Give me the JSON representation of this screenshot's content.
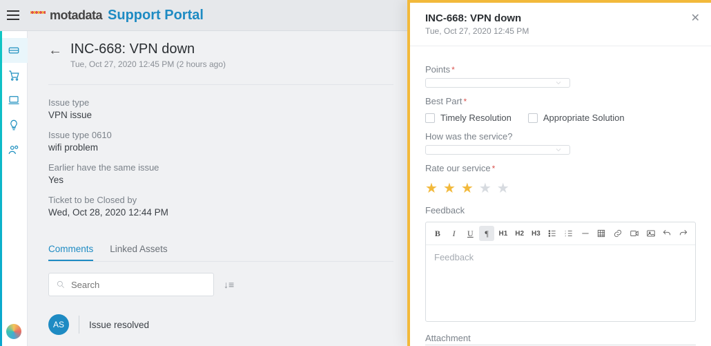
{
  "header": {
    "brand": "motadata",
    "portal": "Support Portal"
  },
  "sidebar": {
    "items": [
      {
        "name": "ticket-icon"
      },
      {
        "name": "cart-icon"
      },
      {
        "name": "laptop-icon"
      },
      {
        "name": "idea-icon"
      },
      {
        "name": "users-icon"
      }
    ]
  },
  "ticket": {
    "title": "INC-668: VPN down",
    "timestamp": "Tue, Oct 27, 2020 12:45 PM (2 hours ago)",
    "fields": [
      {
        "label": "Issue type",
        "value": "VPN issue"
      },
      {
        "label": "Issue type 0610",
        "value": "wifi problem"
      },
      {
        "label": "Earlier have the same issue",
        "value": "Yes"
      },
      {
        "label": "Ticket to be Closed by",
        "value": "Wed, Oct 28, 2020 12:44 PM"
      }
    ],
    "tabs": {
      "comments": "Comments",
      "linked": "Linked Assets"
    },
    "search_placeholder": "Search",
    "comment": {
      "initials": "AS",
      "text": "Issue resolved"
    }
  },
  "panel": {
    "title": "INC-668: VPN down",
    "timestamp": "Tue, Oct 27, 2020 12:45 PM",
    "points_label": "Points",
    "bestpart_label": "Best Part",
    "check_timely": "Timely Resolution",
    "check_solution": "Appropriate Solution",
    "service_label": "How was the service?",
    "rate_label": "Rate our service",
    "rating": 3,
    "feedback_label": "Feedback",
    "feedback_placeholder": "Feedback",
    "attachment_label": "Attachment",
    "toolbar": {
      "h1": "H1",
      "h2": "H2",
      "h3": "H3"
    }
  }
}
